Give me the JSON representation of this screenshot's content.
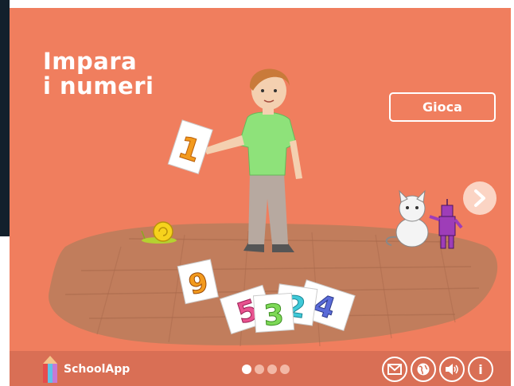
{
  "title": {
    "line1": "Impara",
    "line2": "i numeri"
  },
  "play_label": "Gioca",
  "cards": {
    "held": "1",
    "c9": "9",
    "c5": "5",
    "c3": "3",
    "c2": "2",
    "c4": "4"
  },
  "footer": {
    "brand": "SchoolApp",
    "pages": {
      "count": 4,
      "current": 1
    },
    "icons": [
      "mail-icon",
      "globe-icon",
      "speaker-icon",
      "info-icon"
    ],
    "info_glyph": "i"
  },
  "colors": {
    "background": "#f07e5e",
    "footer": "#d96f55",
    "floor": "#c17d5c",
    "accent_white": "#ffffff"
  }
}
